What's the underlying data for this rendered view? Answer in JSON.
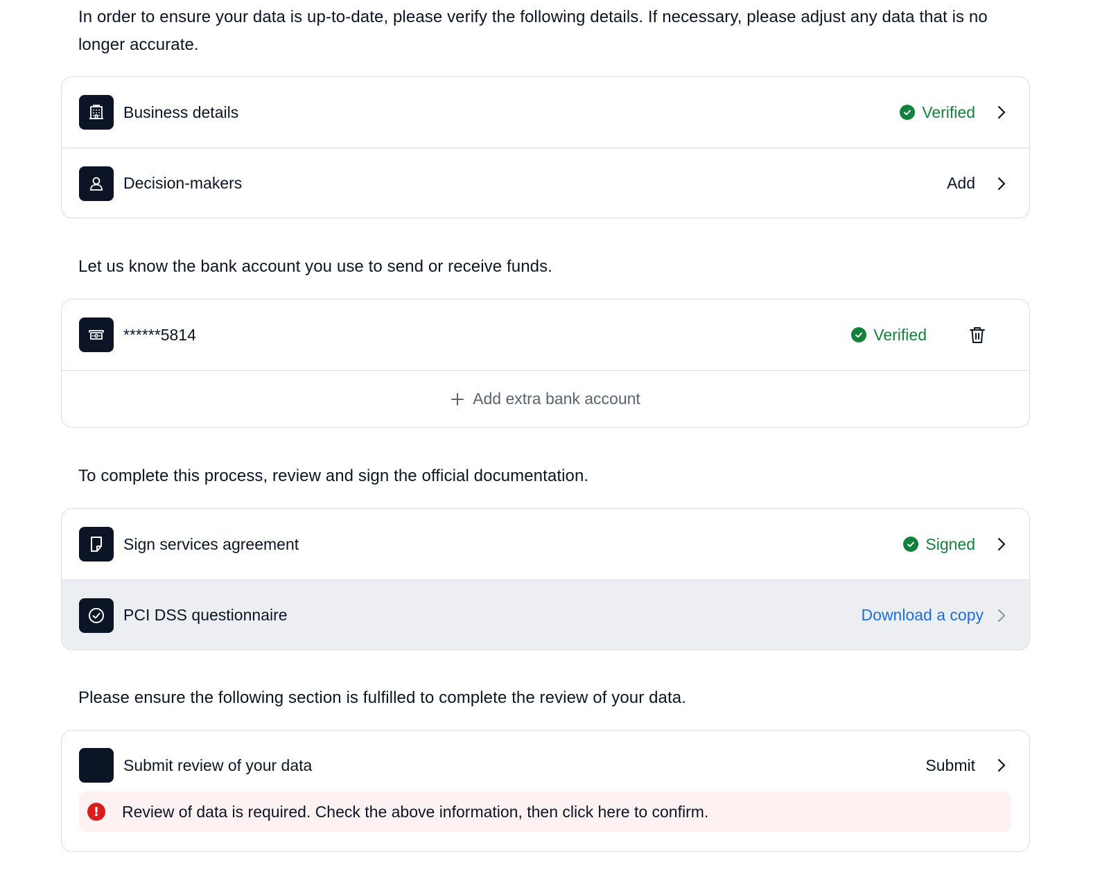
{
  "intro": {
    "personal_details": "In order to ensure your data is up-to-date, please verify the following details. If necessary, please adjust any data that is no longer accurate.",
    "bank": "Let us know the bank account you use to send or receive funds.",
    "documents": "To complete this process, review and sign the official documentation.",
    "review": "Please ensure the following section is fulfilled to complete the review of your data."
  },
  "details": {
    "business": {
      "label": "Business details",
      "status": "Verified",
      "icon": "building-icon"
    },
    "decision_makers": {
      "label": "Decision-makers",
      "action": "Add",
      "icon": "person-icon"
    }
  },
  "bank": {
    "account": {
      "label": "******5814",
      "status": "Verified",
      "icon": "bank-note-icon"
    },
    "add_label": "Add extra bank account"
  },
  "documents": {
    "agreement": {
      "label": "Sign services agreement",
      "status": "Signed",
      "icon": "document-icon"
    },
    "pci": {
      "label": "PCI DSS questionnaire",
      "action": "Download a copy",
      "icon": "check-circle-icon"
    }
  },
  "review": {
    "label": "Submit review of your data",
    "action": "Submit",
    "alert": "Review of data is required. Check the above information, then click here to confirm.",
    "alert_icon": "!"
  },
  "colors": {
    "dark": "#0b1526",
    "success": "#11813d",
    "link": "#1a6fe0",
    "error": "#dd1c1c",
    "error_bg": "#fdf1f1",
    "border": "#dadde3",
    "shaded_row": "#eceef1"
  }
}
